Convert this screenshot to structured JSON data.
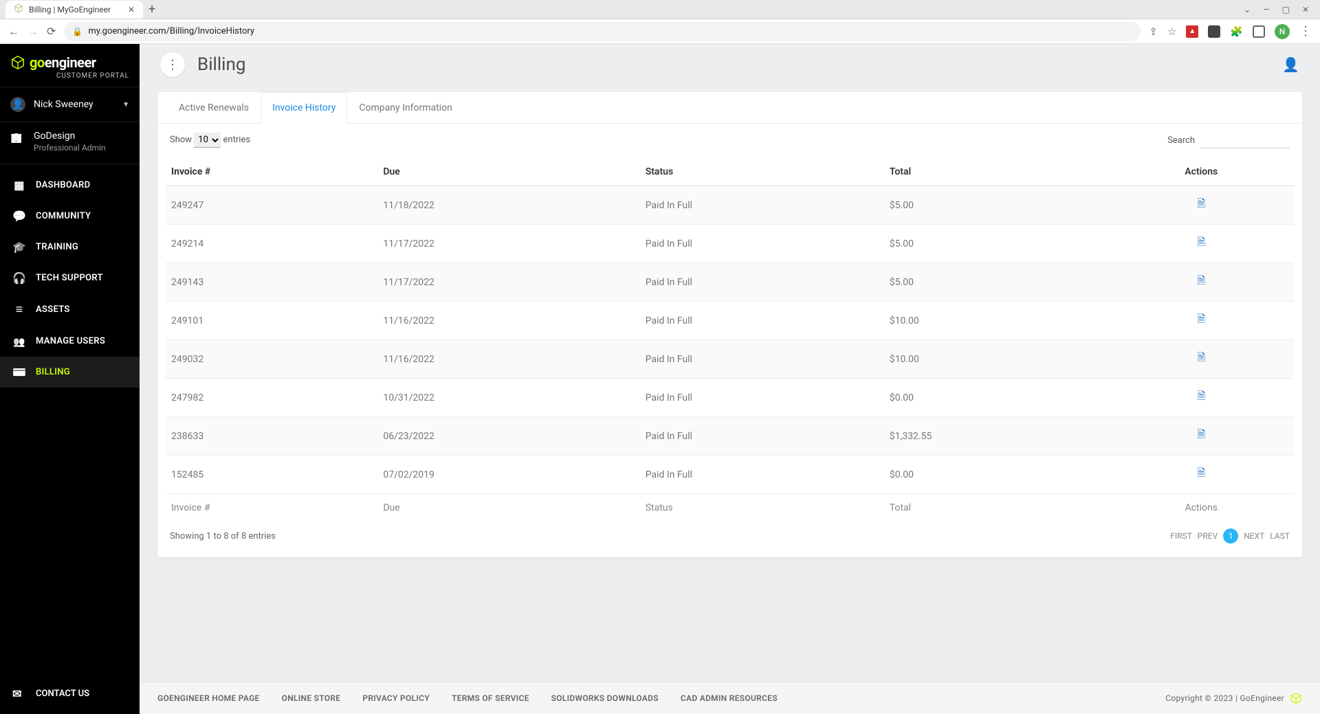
{
  "browser": {
    "tab_title": "Billing | MyGoEngineer",
    "url": "my.goengineer.com/Billing/InvoiceHistory",
    "avatar_letter": "N"
  },
  "app": {
    "logo_go": "go",
    "logo_rest": "engineer",
    "logo_subtitle": "CUSTOMER PORTAL",
    "user_name": "Nick Sweeney",
    "company_name": "GoDesign",
    "company_role": "Professional Admin",
    "nav": {
      "dashboard": "DASHBOARD",
      "community": "COMMUNITY",
      "training": "TRAINING",
      "tech_support": "TECH SUPPORT",
      "assets": "ASSETS",
      "manage_users": "MANAGE USERS",
      "billing": "BILLING",
      "contact_us": "CONTACT US"
    }
  },
  "main": {
    "title": "Billing",
    "tabs": {
      "active_renewals": "Active Renewals",
      "invoice_history": "Invoice History",
      "company_info": "Company Information"
    },
    "show_label": "Show",
    "entries_label": "entries",
    "entries_value": "10",
    "search_label": "Search",
    "columns": {
      "invoice": "Invoice #",
      "due": "Due",
      "status": "Status",
      "total": "Total",
      "actions": "Actions"
    },
    "rows": [
      {
        "invoice": "249247",
        "due": "11/18/2022",
        "status": "Paid In Full",
        "total": "$5.00"
      },
      {
        "invoice": "249214",
        "due": "11/17/2022",
        "status": "Paid In Full",
        "total": "$5.00"
      },
      {
        "invoice": "249143",
        "due": "11/17/2022",
        "status": "Paid In Full",
        "total": "$5.00"
      },
      {
        "invoice": "249101",
        "due": "11/16/2022",
        "status": "Paid In Full",
        "total": "$10.00"
      },
      {
        "invoice": "249032",
        "due": "11/16/2022",
        "status": "Paid In Full",
        "total": "$10.00"
      },
      {
        "invoice": "247982",
        "due": "10/31/2022",
        "status": "Paid In Full",
        "total": "$0.00"
      },
      {
        "invoice": "238633",
        "due": "06/23/2022",
        "status": "Paid In Full",
        "total": "$1,332.55"
      },
      {
        "invoice": "152485",
        "due": "07/02/2019",
        "status": "Paid In Full",
        "total": "$0.00"
      }
    ],
    "showing_text": "Showing 1 to 8 of 8 entries",
    "pager": {
      "first": "FIRST",
      "prev": "PREV",
      "page": "1",
      "next": "NEXT",
      "last": "LAST"
    }
  },
  "footer": {
    "links": {
      "home": "GOENGINEER HOME PAGE",
      "store": "ONLINE STORE",
      "privacy": "PRIVACY POLICY",
      "terms": "TERMS OF SERVICE",
      "solidworks": "SOLIDWORKS DOWNLOADS",
      "cad": "CAD ADMIN RESOURCES"
    },
    "copyright": "Copyright © 2023 | GoEngineer"
  }
}
